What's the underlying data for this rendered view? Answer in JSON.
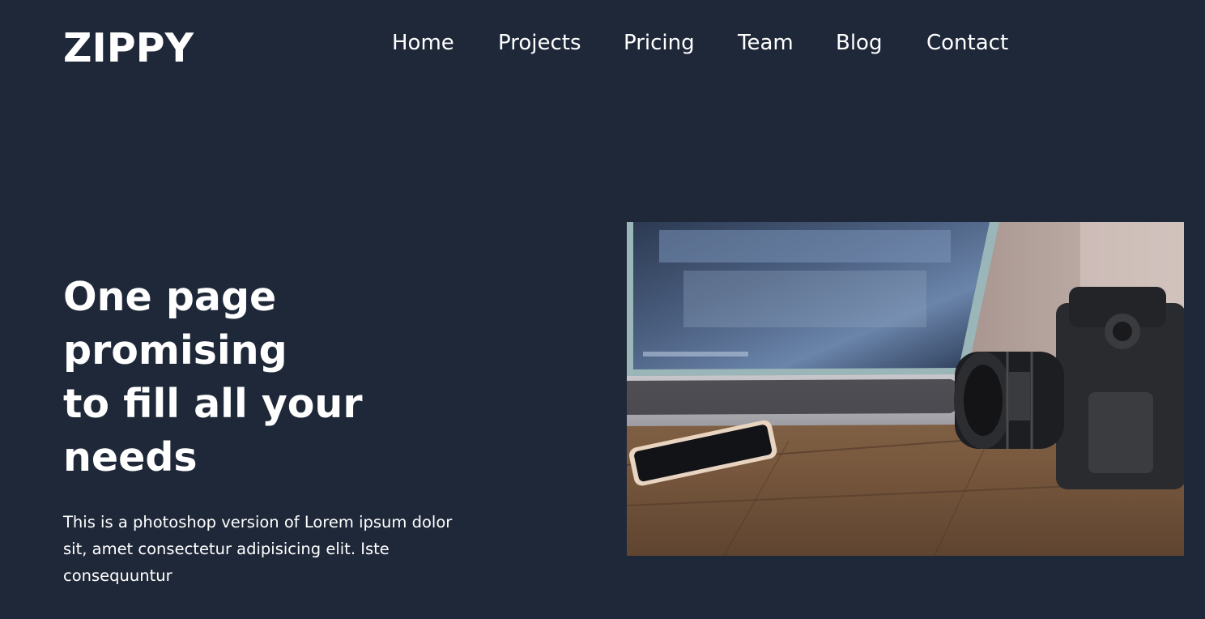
{
  "brand": {
    "logo": "ZIPPY"
  },
  "nav": {
    "items": [
      {
        "label": "Home"
      },
      {
        "label": "Projects"
      },
      {
        "label": "Pricing"
      },
      {
        "label": "Team"
      },
      {
        "label": "Blog"
      },
      {
        "label": "Contact"
      }
    ]
  },
  "hero": {
    "title_lines": [
      "One page",
      "promising",
      "to fill all your",
      "needs"
    ],
    "description_lines": [
      "This is a photoshop version of Lorem ipsum dolor",
      "sit, amet consectetur adipisicing elit. Iste",
      "consequuntur"
    ],
    "image_subject": "laptop, smartphone and camera on wooden desk"
  },
  "colors": {
    "background": "#1f2839",
    "text": "#ffffff"
  }
}
